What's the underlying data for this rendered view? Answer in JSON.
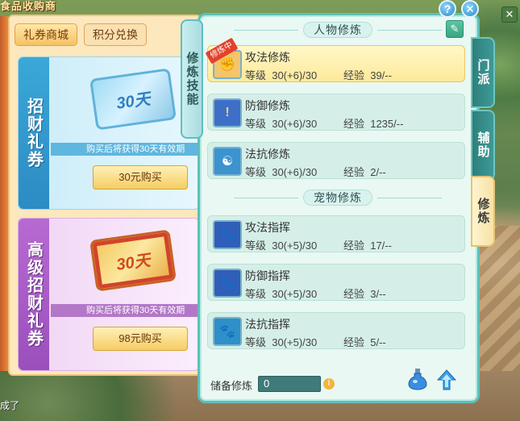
{
  "background": {
    "shop_title": "食品收购商",
    "bottom_text": "成了"
  },
  "shop": {
    "tabs": [
      {
        "label": "礼券商城",
        "active": true
      },
      {
        "label": "积分兑换",
        "active": false
      }
    ],
    "cards": [
      {
        "side_label": "招财礼券",
        "ticket_text": "30天",
        "desc": "购买后将获得30天有效期",
        "buy_label": "30元购买"
      },
      {
        "side_label": "高级招财礼券",
        "ticket_text": "30天",
        "desc": "购买后将获得30天有效期",
        "buy_label": "98元购买"
      }
    ]
  },
  "panel": {
    "left_tab": "修炼技能",
    "right_tabs": [
      {
        "label": "门派",
        "active": false
      },
      {
        "label": "辅助",
        "active": false
      },
      {
        "label": "修炼",
        "active": true
      }
    ],
    "help_label": "?",
    "close_label": "✕",
    "edit_icon": "✎",
    "sections": [
      {
        "title": "人物修炼",
        "rows": [
          {
            "name": "攻法修炼",
            "level": "等级  30(+6)/30",
            "exp": "经验  39/--",
            "badge": "修炼中",
            "selected": true,
            "icon": "fist-icon",
            "icon_color": "#d46a1e"
          },
          {
            "name": "防御修炼",
            "level": "等级  30(+6)/30",
            "exp": "经验  1235/--",
            "badge": "",
            "selected": false,
            "icon": "shield-icon",
            "icon_color": "#2f5fb8"
          },
          {
            "name": "法抗修炼",
            "level": "等级  30(+6)/30",
            "exp": "经验  2/--",
            "badge": "",
            "selected": false,
            "icon": "shield-icon",
            "icon_color": "#2f8fc8"
          }
        ]
      },
      {
        "title": "宠物修炼",
        "rows": [
          {
            "name": "攻法指挥",
            "level": "等级  30(+5)/30",
            "exp": "经验  17/--",
            "badge": "",
            "selected": false,
            "icon": "paw-icon",
            "icon_color": "#d46a1e"
          },
          {
            "name": "防御指挥",
            "level": "等级  30(+5)/30",
            "exp": "经验  3/--",
            "badge": "",
            "selected": false,
            "icon": "paw-icon",
            "icon_color": "#2f5fb8"
          },
          {
            "name": "法抗指挥",
            "level": "等级  30(+5)/30",
            "exp": "经验  5/--",
            "badge": "",
            "selected": false,
            "icon": "paw-icon",
            "icon_color": "#2f8fc8"
          }
        ]
      }
    ],
    "reserve": {
      "label": "储备修炼",
      "value": "0"
    }
  }
}
